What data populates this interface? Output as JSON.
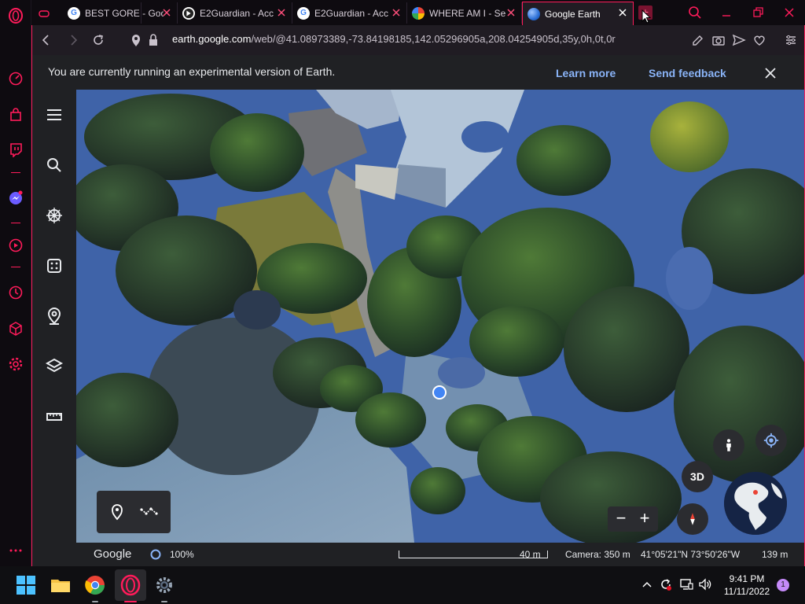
{
  "browser": {
    "tabs": [
      {
        "title": "BEST GORE - Goo",
        "favicon": "google-g-icon"
      },
      {
        "title": "E2Guardian - Acc",
        "favicon": "e2guardian-icon"
      },
      {
        "title": "E2Guardian - Acc",
        "favicon": "google-g-icon"
      },
      {
        "title": "WHERE AM I - Se",
        "favicon": "google-g-icon"
      },
      {
        "title": "Google Earth",
        "favicon": "earth-icon",
        "active": true
      }
    ],
    "url_host": "earth.google.com",
    "url_path": "/web/@41.08973389,-73.84198185,142.05296905a,208.04254905d,35y,0h,0t,0r"
  },
  "banner": {
    "message": "You are currently running an experimental version of Earth.",
    "learn_more": "Learn more",
    "send_feedback": "Send feedback"
  },
  "map_controls": {
    "toggle_3d": "3D",
    "zoom_out": "−",
    "zoom_in": "+"
  },
  "status": {
    "brand": "Google",
    "loading": "100%",
    "scale": "40 m",
    "camera": "Camera: 350 m",
    "coordinates": "41°05'21\"N 73°50'26\"W",
    "elevation": "139 m"
  },
  "taskbar": {
    "time": "9:41 PM",
    "date": "11/11/2022",
    "notifications": "1"
  },
  "colors": {
    "opera_accent": "#ff1b5a",
    "link_blue": "#8ab4f8",
    "map_water_tint": "#3f63a8"
  }
}
